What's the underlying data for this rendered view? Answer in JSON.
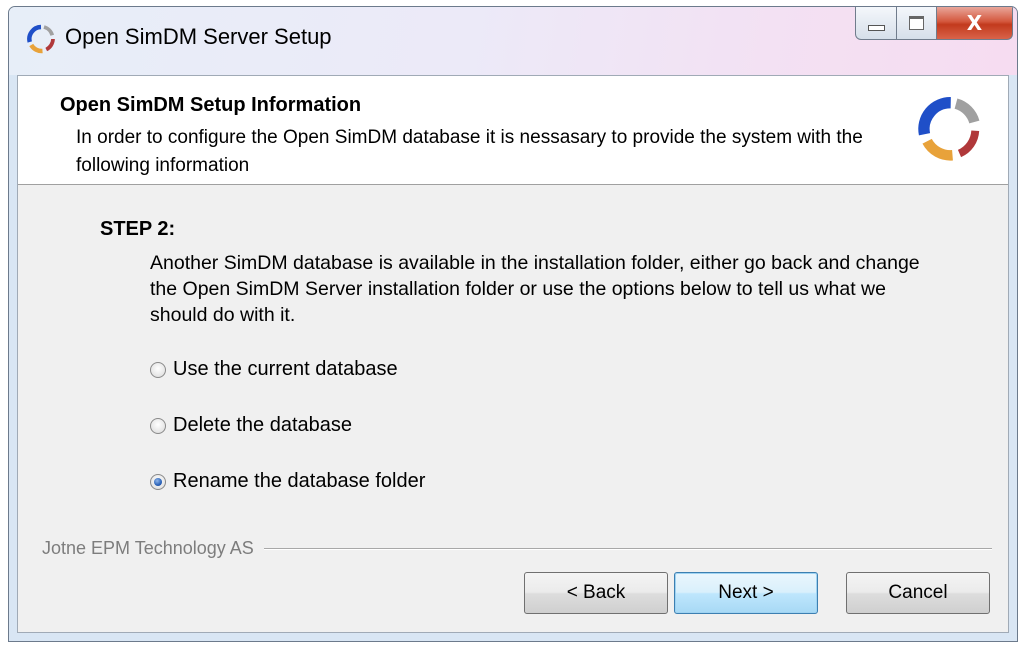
{
  "window": {
    "title": "Open SimDM Server Setup",
    "app_icon": "simdm-logo-icon",
    "caption_buttons": {
      "minimize_icon": "minimize-icon",
      "maximize_icon": "maximize-icon",
      "close_label": "X"
    }
  },
  "header": {
    "title": "Open SimDM Setup Information",
    "description": "In order to configure the Open SimDM database it is nessasary to provide the system with the following information",
    "logo_icon": "simdm-logo-icon"
  },
  "step": {
    "title": "STEP 2:",
    "text": "Another SimDM database is available in the installation folder, either go back and change the Open SimDM Server installation folder or use the options below to tell us what we should do with it."
  },
  "options": [
    {
      "label": "Use the current database",
      "checked": false
    },
    {
      "label": "Delete the database",
      "checked": false
    },
    {
      "label": "Rename the database folder",
      "checked": true
    }
  ],
  "branding": {
    "text": "Jotne EPM Technology AS"
  },
  "buttons": {
    "back": "< Back",
    "next": "Next >",
    "cancel": "Cancel"
  },
  "colors": {
    "logo_blue": "#1f4fc8",
    "logo_orange": "#e8a23a",
    "logo_red": "#b0383a",
    "logo_gray": "#a0a0a0",
    "default_button_border": "#3c7fb1"
  }
}
